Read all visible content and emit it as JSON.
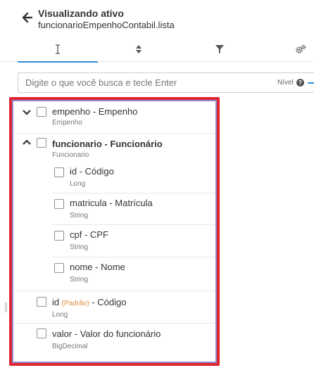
{
  "header": {
    "title": "Visualizando ativo",
    "subtitle": "funcionarioEmpenhoContabil.lista"
  },
  "tabs": [
    {
      "icon": "text-cursor-icon"
    },
    {
      "icon": "sort-icon"
    },
    {
      "icon": "filter-icon"
    },
    {
      "icon": "gears-icon"
    }
  ],
  "search": {
    "placeholder": "Digite o que você busca e tecle Enter",
    "value": "",
    "level_label": "Nível",
    "help_glyph": "?"
  },
  "tree": {
    "empenho": {
      "label": "empenho - Empenho",
      "type": "Empenho",
      "expanded": false
    },
    "funcionario": {
      "label": "funcionario - Funcionário",
      "type": "Funcionario",
      "expanded": true,
      "children": [
        {
          "label": "id - Código",
          "type": "Long"
        },
        {
          "label": "matricula - Matrícula",
          "type": "String"
        },
        {
          "label": "cpf - CPF",
          "type": "String"
        },
        {
          "label": "nome - Nome",
          "type": "String"
        }
      ]
    },
    "id": {
      "prefix": "id",
      "badge": "(Padrão)",
      "suffix": "- Código",
      "type": "Long"
    },
    "valor": {
      "label": "valor - Valor do funcionário",
      "type": "BigDecimal"
    }
  },
  "colors": {
    "accent": "#2f8fd8",
    "highlight_border": "#e0242f",
    "panel_border": "#8c8fd0",
    "default_badge": "#e08a3a"
  }
}
